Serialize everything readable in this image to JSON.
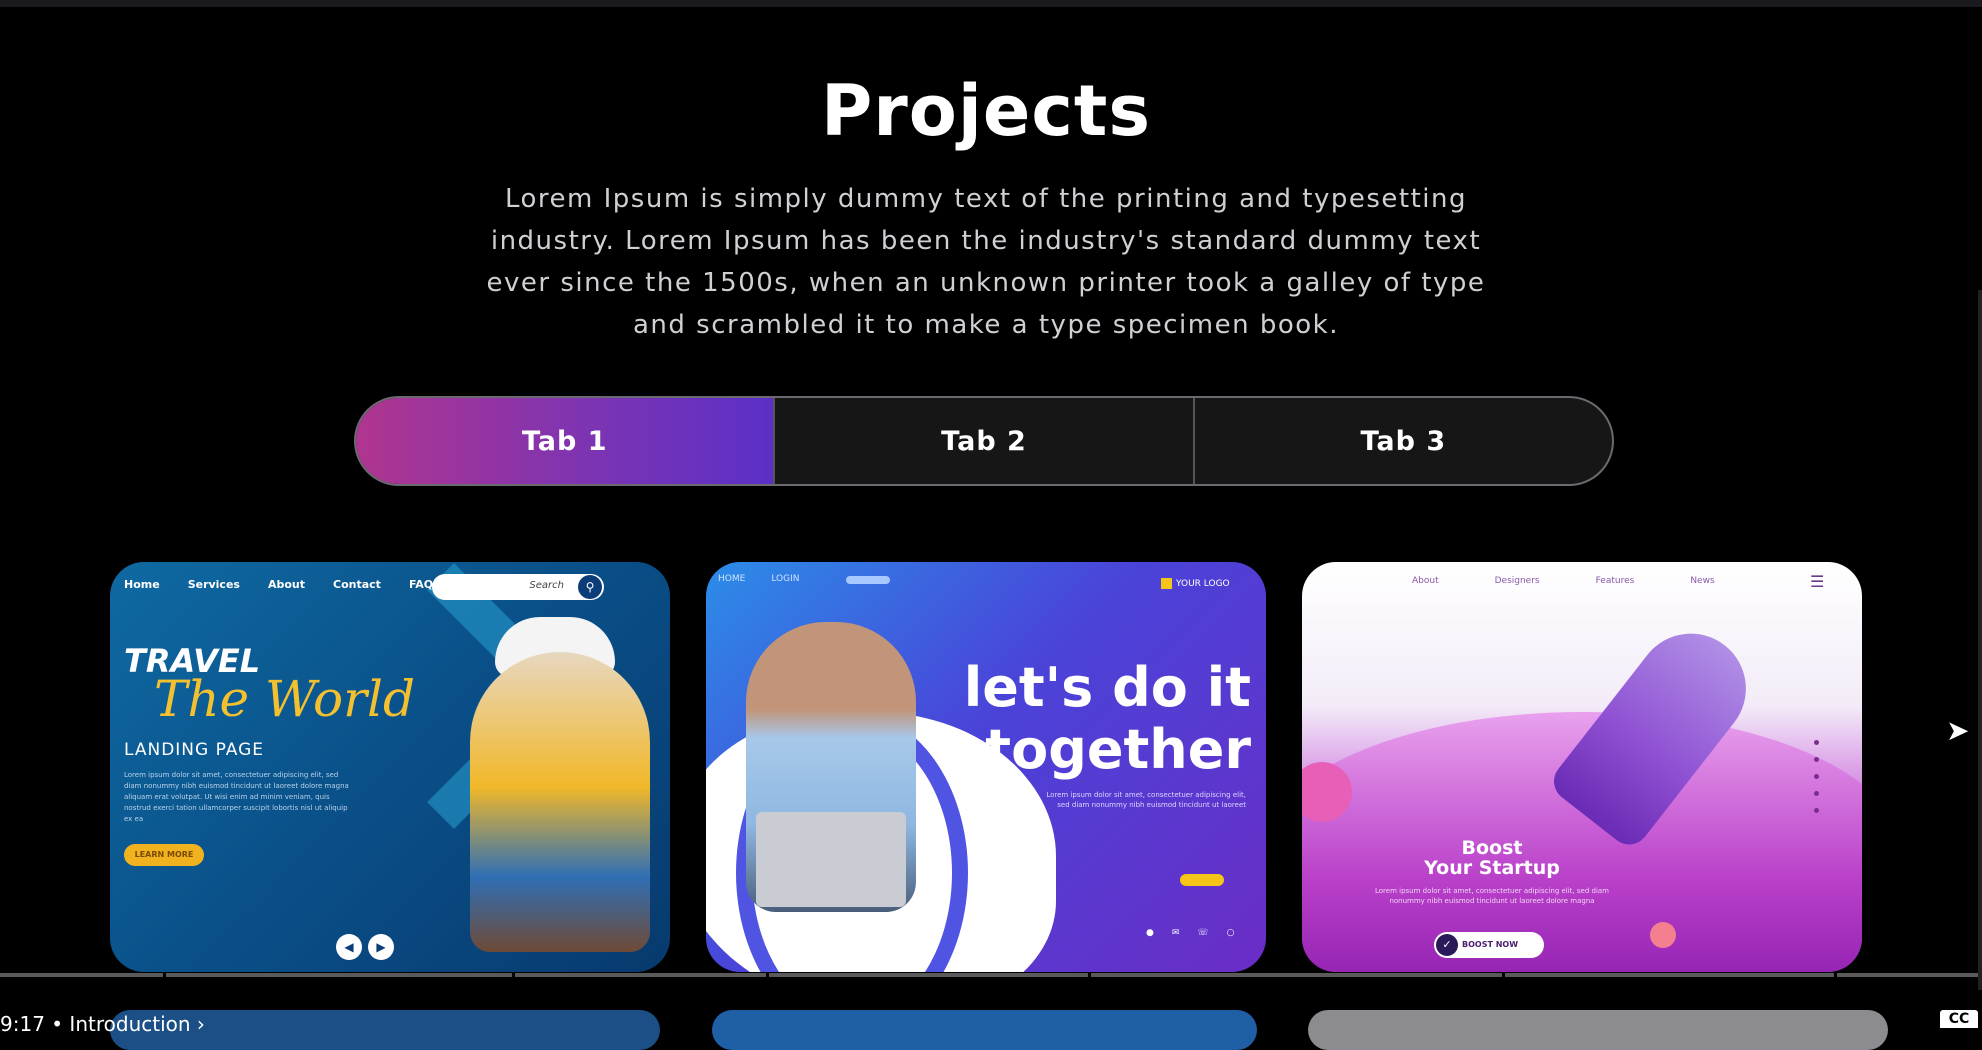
{
  "section": {
    "title": "Projects",
    "description": "Lorem Ipsum is simply dummy text of the printing and typesetting industry. Lorem Ipsum has been the industry's standard dummy text ever since the 1500s, when an unknown printer took a galley of type and scrambled it to make a type specimen book."
  },
  "tabs": [
    {
      "label": "Tab 1",
      "active": true
    },
    {
      "label": "Tab 2",
      "active": false
    },
    {
      "label": "Tab 3",
      "active": false
    }
  ],
  "cards": {
    "travel": {
      "nav": [
        "Home",
        "Services",
        "About",
        "Contact",
        "FAQ"
      ],
      "search_label": "Search",
      "title_line1": "TRAVEL",
      "title_line2": "The World",
      "subtitle": "LANDING PAGE",
      "body": "Lorem ipsum dolor sit amet, consectetuer adipiscing elit, sed diam nonummy nibh euismod tincidunt ut laoreet dolore magna aliquam erat volutpat. Ut wisi enim ad minim veniam, quis nostrud exerci tation ullamcorper suscipit lobortis nisl ut aliquip ex ea",
      "button": "LEARN MORE"
    },
    "together": {
      "nav": [
        "HOME",
        "LOGIN"
      ],
      "logo": "YOUR LOGO",
      "headline_line1": "let's do it",
      "headline_line2": "together",
      "body": "Lorem ipsum dolor sit amet, consectetuer adipiscing elit, sed diam nonummy nibh euismod tincidunt ut laoreet"
    },
    "startup": {
      "nav": [
        "About",
        "Designers",
        "Features",
        "News"
      ],
      "headline_line1": "Boost",
      "headline_line2": "Your Startup",
      "body": "Lorem ipsum dolor sit amet, consectetuer adipiscing elit, sed diam nonummy nibh euismod tincidunt ut laoreet dolore magna",
      "button": "BOOST NOW"
    }
  },
  "player": {
    "time": "9:17",
    "chapter": "• Introduction",
    "chevron": "›",
    "cc": "CC"
  },
  "colors": {
    "background": "#000000",
    "tab_active_start": "#b0358f",
    "tab_active_end": "#5b30c7"
  }
}
